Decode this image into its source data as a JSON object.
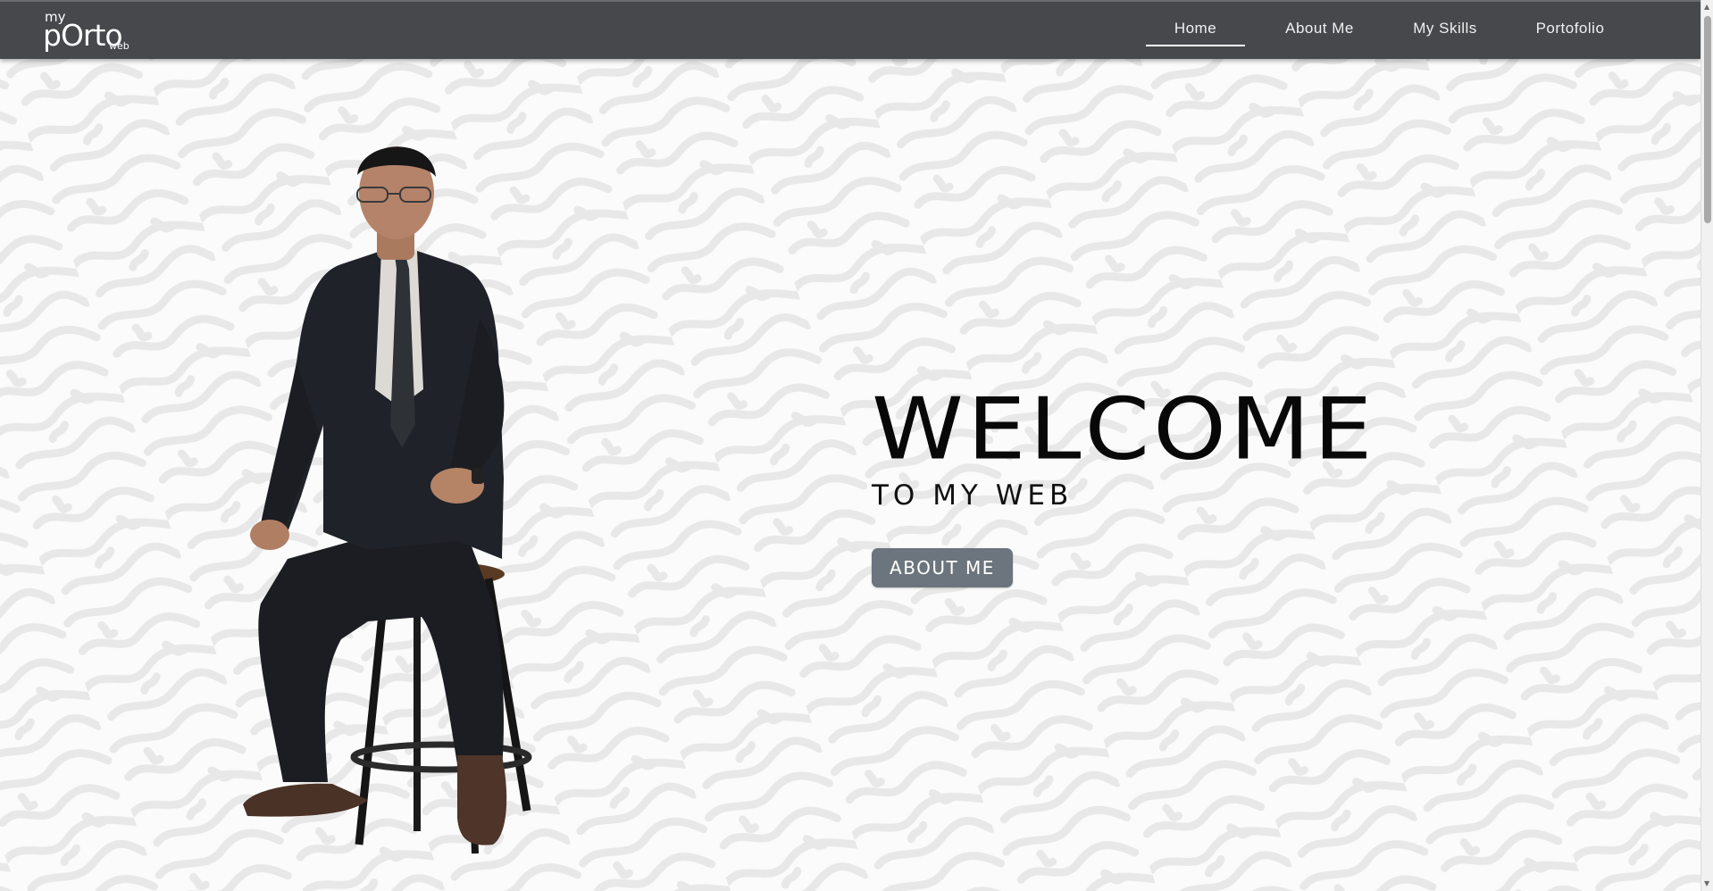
{
  "logo": {
    "top": "my",
    "main": "pOrto",
    "sub": "web"
  },
  "nav": {
    "items": [
      {
        "label": "Home",
        "active": true
      },
      {
        "label": "About Me",
        "active": false
      },
      {
        "label": "My Skills",
        "active": false
      },
      {
        "label": "Portofolio",
        "active": false
      }
    ]
  },
  "hero": {
    "title": "WELCOME",
    "subtitle": "TO MY WEB",
    "button_label": "ABOUT ME"
  },
  "colors": {
    "navbar": "#46484b",
    "button": "#6c757d",
    "text": "#080808",
    "pattern": "#e9e9e9"
  }
}
